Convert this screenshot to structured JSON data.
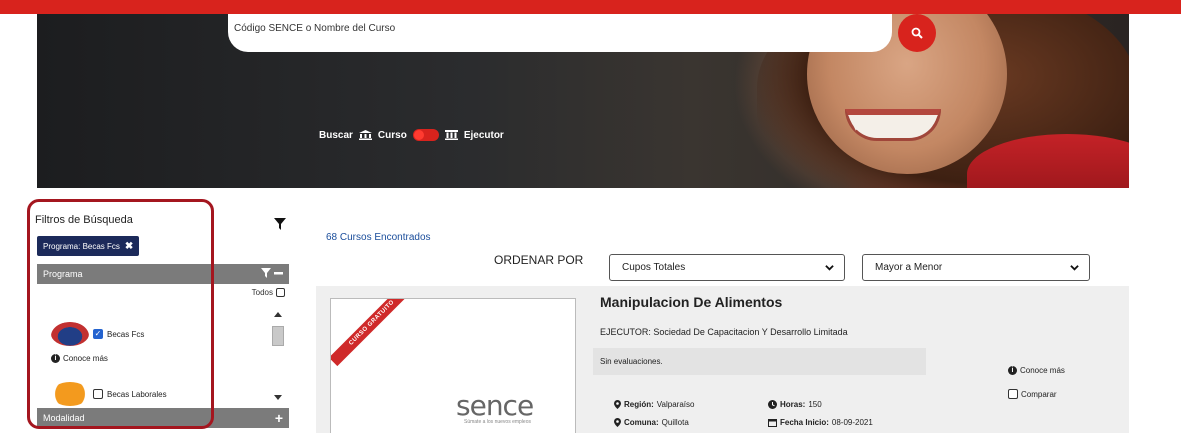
{
  "search": {
    "placeholder": "Código SENCE o Nombre del Curso",
    "buscar_label": "Buscar",
    "curso_label": "Curso",
    "ejecutor_label": "Ejecutor"
  },
  "sidebar": {
    "title": "Filtros de Búsqueda",
    "active_filter": "Programa: Becas Fcs",
    "active_filter_remove": "✖",
    "programa_header": "Programa",
    "todos_label": "Todos",
    "items": [
      {
        "label": "Becas Fcs",
        "checked": true
      },
      {
        "label": "Becas Laborales",
        "checked": false
      }
    ],
    "conoce_mas": "Conoce más",
    "modalidad_header": "Modalidad",
    "modalidad_toggle": "+"
  },
  "results": {
    "count": "68 Cursos Encontrados",
    "sort_label": "ORDENAR POR",
    "sort_field": "Cupos Totales",
    "sort_order": "Mayor a Menor"
  },
  "course": {
    "ribbon": "CURSO GRATUITO",
    "logo_text": "sence",
    "logo_tagline": "Súmate a los nuevos empleos",
    "title": "Manipulacion De Alimentos",
    "ejecutor": "EJECUTOR: Sociedad De Capacitacion Y Desarrollo Limitada",
    "evaluations": "Sin evaluaciones.",
    "region_label": "Región:",
    "region_value": "Valparaíso",
    "comuna_label": "Comuna:",
    "comuna_value": "Quillota",
    "horas_label": "Horas:",
    "horas_value": "150",
    "fecha_label": "Fecha Inicio:",
    "fecha_value": "08-09-2021",
    "conoce_mas": "Conoce más",
    "comparar": "Comparar"
  },
  "colors": {
    "brand_red": "#d8231d",
    "chip_navy": "#1c2a5a",
    "panel_gray": "#7b7b7b",
    "link_blue": "#1a4d9b"
  }
}
